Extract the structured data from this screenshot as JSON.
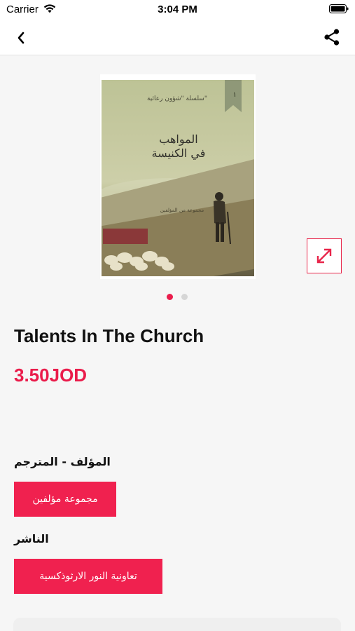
{
  "status_bar": {
    "carrier": "Carrier",
    "time": "3:04 PM"
  },
  "nav": {
    "back_icon": "chevron-left-icon",
    "share_icon": "share-icon"
  },
  "cover": {
    "series": "سلسلة \"شؤون رعائية\"",
    "bookmark_number": "١",
    "title_line1": "المواهب",
    "title_line2": "في الكنيسة",
    "authors": "مجموعة من المؤلفين"
  },
  "gallery": {
    "total_pages": 2,
    "current_page": 1,
    "expand_icon": "expand-arrows-icon"
  },
  "product": {
    "title": "Talents In The Church",
    "price": "3.50JOD"
  },
  "details": {
    "author_label": "المؤلف - المترجم",
    "author_value": "مجموعة مؤلفين",
    "publisher_label": "الناشر",
    "publisher_value": "تعاونية النور الارثوذكسية"
  },
  "colors": {
    "accent": "#ea1c4b",
    "chip": "#f0214f",
    "background": "#f6f6f6"
  }
}
